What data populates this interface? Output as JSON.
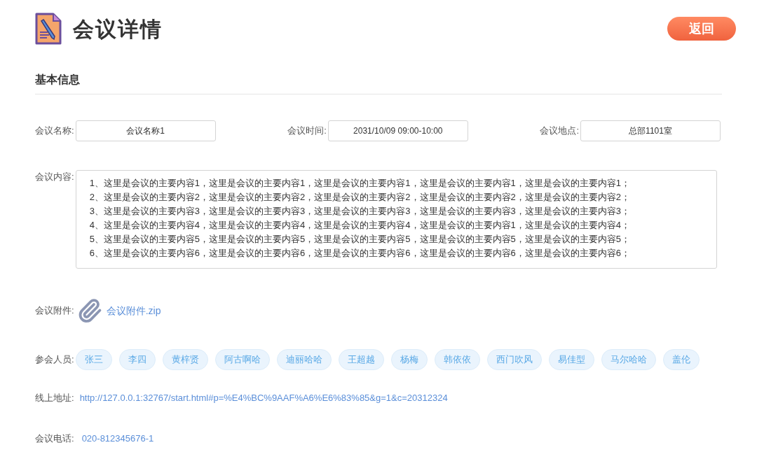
{
  "header": {
    "title": "会议详情",
    "back_button": "返回"
  },
  "section": {
    "title": "基本信息"
  },
  "fields": [
    {
      "label": "会议名称:",
      "value": "会议名称1"
    },
    {
      "label": "会议时间:",
      "value": "2031/10/09 09:00-10:00"
    },
    {
      "label": "会议地点:",
      "value": "总部1101室"
    }
  ],
  "content": {
    "label": "会议内容:",
    "lines": [
      "1、这里是会议的主要内容1，这里是会议的主要内容1，这里是会议的主要内容1，这里是会议的主要内容1，这里是会议的主要内容1；",
      "2、这里是会议的主要内容2，这里是会议的主要内容2，这里是会议的主要内容2，这里是会议的主要内容2，这里是会议的主要内容2；",
      "3、这里是会议的主要内容3，这里是会议的主要内容3，这里是会议的主要内容3，这里是会议的主要内容3，这里是会议的主要内容3；",
      "4、这里是会议的主要内容4，这里是会议的主要内容4，这里是会议的主要内容4，这里是会议的主要内容1，这里是会议的主要内容4；",
      "5、这里是会议的主要内容5，这里是会议的主要内容5，这里是会议的主要内容5，这里是会议的主要内容5，这里是会议的主要内容5；",
      "6、这里是会议的主要内容6，这里是会议的主要内容6，这里是会议的主要内容6，这里是会议的主要内容6，这里是会议的主要内容6；"
    ]
  },
  "attachment": {
    "label": "会议附件:",
    "file": "会议附件.zip"
  },
  "attendees": {
    "label": "参会人员:",
    "names": [
      "张三",
      "李四",
      "黄梓贤",
      "阿古啊哈",
      "迪丽哈哈",
      "王超越",
      "杨梅",
      "韩依依",
      "西门吹风",
      "易佳型",
      "马尔哈哈",
      "盖伦"
    ]
  },
  "online_url": {
    "label": "线上地址:",
    "url": "http://127.0.0.1:32767/start.html#p=%E4%BC%9AAF%A6%E6%83%85&g=1&c=20312324"
  },
  "phone": {
    "label": "会议电话:",
    "number": "020-812345676-1"
  }
}
